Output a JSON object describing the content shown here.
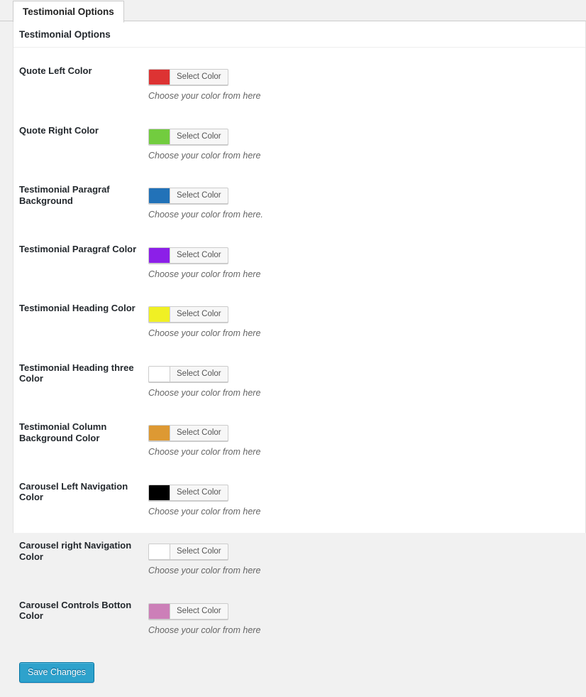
{
  "tabs": [
    {
      "label": "Testimonial Options",
      "active": true
    }
  ],
  "panel": {
    "title": "Testimonial Options"
  },
  "color_button_label": "Select Color",
  "fields": [
    {
      "label": "Quote Left Color",
      "color": "#dd3333",
      "button": "Select Color",
      "description": "Choose your color from here"
    },
    {
      "label": "Quote Right Color",
      "color": "#72cc3f",
      "button": "Select Color",
      "description": "Choose your color from here"
    },
    {
      "label": "Testimonial Paragraf Background",
      "color": "#2272b8",
      "button": "Select Color",
      "description": "Choose your color from here."
    },
    {
      "label": "Testimonial Paragraf Color",
      "color": "#8c1fe8",
      "button": "Select Color",
      "description": "Choose your color from here"
    },
    {
      "label": "Testimonial Heading Color",
      "color": "#f0f024",
      "button": "Select Color",
      "description": "Choose your color from here"
    },
    {
      "label": "Testimonial Heading three Color",
      "color": "#ffffff",
      "button": "Select Color",
      "description": "Choose your color from here"
    },
    {
      "label": "Testimonial Column Background Color",
      "color": "#dd9933",
      "button": "Select Color",
      "description": "Choose your color from here"
    },
    {
      "label": "Carousel Left Navigation Color",
      "color": "#000000",
      "button": "Select Color",
      "description": "Choose your color from here"
    },
    {
      "label": "Carousel right Navigation Color",
      "color": "#ffffff",
      "button": "Select Color",
      "description": "Choose your color from here"
    },
    {
      "label": "Carousel Controls Botton Color",
      "color": "#cc7fb8",
      "button": "Select Color",
      "description": "Choose your color from here"
    }
  ],
  "submit": {
    "label": "Save Changes",
    "accent": "#2ea2cc"
  }
}
